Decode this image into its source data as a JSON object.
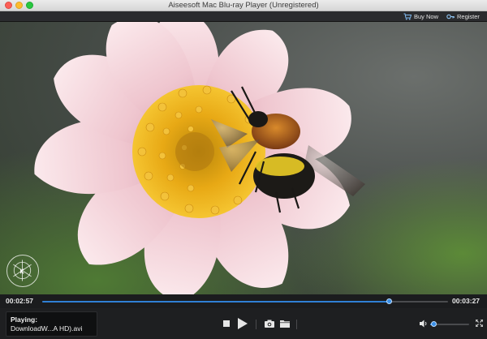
{
  "window": {
    "title": "Aiseesoft Mac Blu-ray Player (Unregistered)"
  },
  "topbar": {
    "buy_label": "Buy Now",
    "register_label": "Register"
  },
  "playback": {
    "elapsed": "00:02:57",
    "total": "00:03:27",
    "progress": 0.855,
    "volume": 0.1
  },
  "now_playing": {
    "label": "Playing:",
    "file": "DownloadW...A HD).avi"
  },
  "colors": {
    "accent": "#2f7fd4",
    "background": "#1e1f21"
  },
  "icons": {
    "stop": "stop-icon",
    "play": "play-icon",
    "snapshot": "camera-icon",
    "open": "folder-icon",
    "volume": "speaker-icon",
    "fullscreen": "fullscreen-icon",
    "buy": "cart-icon",
    "register": "key-icon"
  }
}
